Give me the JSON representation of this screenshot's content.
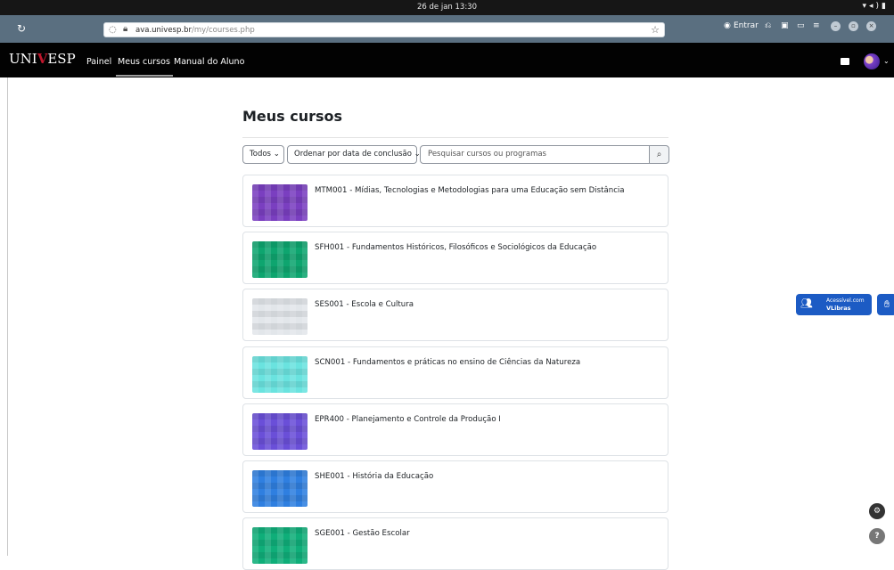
{
  "os": {
    "clock": "26 de jan  13:30"
  },
  "browser": {
    "url_host": "ava.univesp.br",
    "url_path": "/my/courses.php",
    "signin_label": "Entrar"
  },
  "nav": {
    "logo_prefix": "UNI",
    "logo_v": "V",
    "logo_suffix": "ESP",
    "links": [
      "Painel",
      "Meus cursos",
      "Manual do Aluno"
    ]
  },
  "main": {
    "title": "Meus cursos",
    "filter_all": "Todos",
    "sort_label": "Ordenar por data de conclusão",
    "search_placeholder": "Pesquisar cursos ou programas"
  },
  "courses": [
    {
      "name": "MTM001 - Mídias, Tecnologias e Metodologias para uma Educação sem Distância",
      "color": "#7a3fc0"
    },
    {
      "name": "SFH001 - Fundamentos Históricos, Filosóficos e Sociológicos da Educação",
      "color": "#0ea56f"
    },
    {
      "name": "SES001 - Escola e Cultura",
      "color": "#e2e6ea"
    },
    {
      "name": "SCN001 - Fundamentos e práticas no ensino de Ciências da Natureza",
      "color": "#6ae3df"
    },
    {
      "name": "EPR400 - Planejamento e Controle da Produção I",
      "color": "#6a4fd8"
    },
    {
      "name": "SHE001 - História da Educação",
      "color": "#2f7fe0"
    },
    {
      "name": "SGE001 - Gestão Escolar",
      "color": "#0fae79"
    }
  ],
  "vlibras": {
    "line1": "Acessível.com",
    "line2": "VLibras"
  },
  "colors": {
    "nav_bg": "#020202",
    "browser_bar": "#5a6f80",
    "accent": "#c0172d",
    "vlibras": "#1c5bc4"
  }
}
